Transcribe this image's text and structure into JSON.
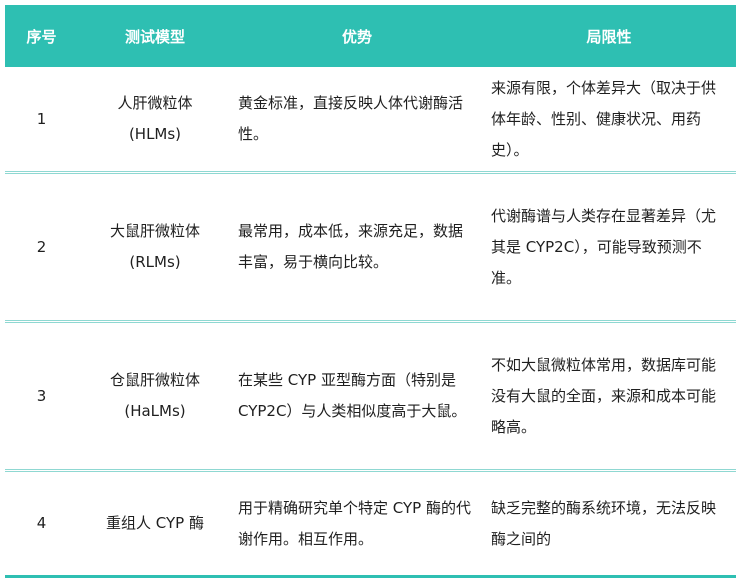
{
  "headers": [
    "序号",
    "测试模型",
    "优势",
    "局限性"
  ],
  "rows": [
    {
      "no": "1",
      "model_name": "人肝微粒体",
      "model_abbr": "(HLMs)",
      "advantage": "黄金标准，直接反映人体代谢酶活性。",
      "limitation": "来源有限，个体差异大（取决于供体年龄、性别、健康状况、用药史）。"
    },
    {
      "no": "2",
      "model_name": "大鼠肝微粒体",
      "model_abbr": "(RLMs)",
      "advantage": "最常用，成本低，来源充足，数据丰富，易于横向比较。",
      "limitation": "代谢酶谱与人类存在显著差异（尤其是 CYP2C），可能导致预测不准。"
    },
    {
      "no": "3",
      "model_name": "仓鼠肝微粒体",
      "model_abbr": "(HaLMs)",
      "advantage": "在某些 CYP 亚型酶方面（特别是 CYP2C）与人类相似度高于大鼠。",
      "limitation": "不如大鼠微粒体常用，数据库可能没有大鼠的全面，来源和成本可能略高。"
    },
    {
      "no": "4",
      "model_name": "重组人 CYP 酶",
      "model_abbr": "",
      "advantage": "用于精确研究单个特定 CYP 酶的代谢作用。相互作用。",
      "limitation": "缺乏完整的酶系统环境，无法反映酶之间的"
    }
  ]
}
